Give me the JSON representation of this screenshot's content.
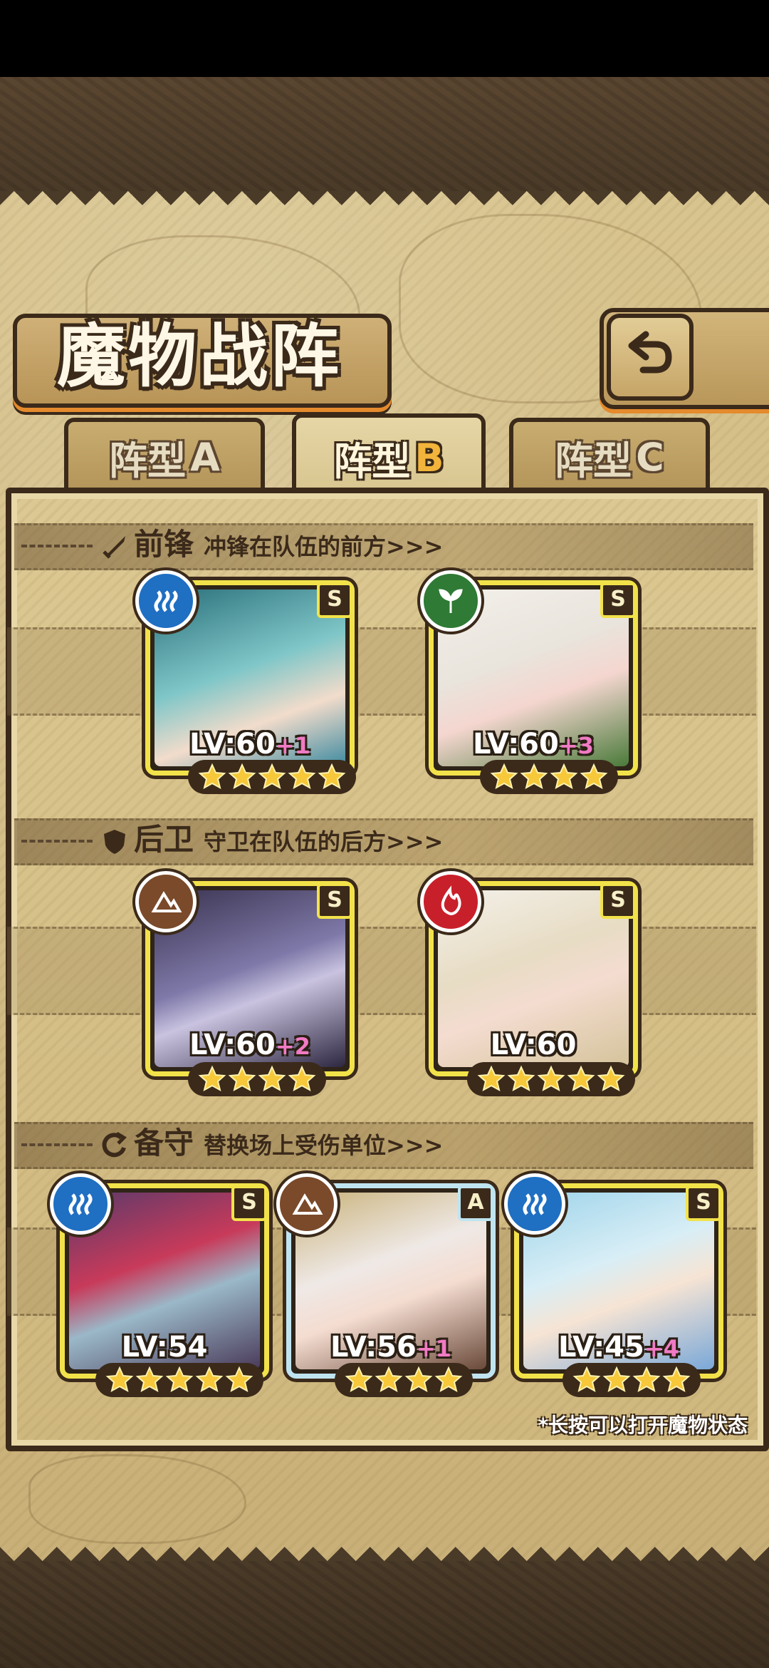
{
  "header": {
    "title": "魔物战阵"
  },
  "tabs": [
    {
      "label": "阵型",
      "letter": "A",
      "active": false
    },
    {
      "label": "阵型",
      "letter": "B",
      "active": true
    },
    {
      "label": "阵型",
      "letter": "C",
      "active": false
    }
  ],
  "sections": {
    "front": {
      "title": "前锋",
      "desc": "冲锋在队伍的前方>>>"
    },
    "rear": {
      "title": "后卫",
      "desc": "守卫在队伍的后方>>>"
    },
    "reserve": {
      "title": "备守",
      "desc": "替换场上受伤单位>>>"
    }
  },
  "units": {
    "front": [
      {
        "element": "water",
        "rank": "S",
        "level": "LV:60",
        "plus": "+1",
        "stars": 5
      },
      {
        "element": "wood",
        "rank": "S",
        "level": "LV:60",
        "plus": "+3",
        "stars": 4
      }
    ],
    "rear": [
      {
        "element": "earth",
        "rank": "S",
        "level": "LV:60",
        "plus": "+2",
        "stars": 4
      },
      {
        "element": "fire",
        "rank": "S",
        "level": "LV:60",
        "plus": "",
        "stars": 5
      }
    ],
    "reserve": [
      {
        "element": "water",
        "rank": "S",
        "level": "LV:54",
        "plus": "",
        "stars": 5
      },
      {
        "element": "earth",
        "rank": "A",
        "level": "LV:56",
        "plus": "+1",
        "stars": 4
      },
      {
        "element": "water",
        "rank": "S",
        "level": "LV:45",
        "plus": "+4",
        "stars": 4
      }
    ]
  },
  "hint": "*长按可以打开魔物状态",
  "colors": {
    "frame": "#3b2a1a",
    "accent": "#e58a2d",
    "card_s": "#f2e24a",
    "card_a": "#bfe4f0",
    "plus": "#f07ac4"
  }
}
